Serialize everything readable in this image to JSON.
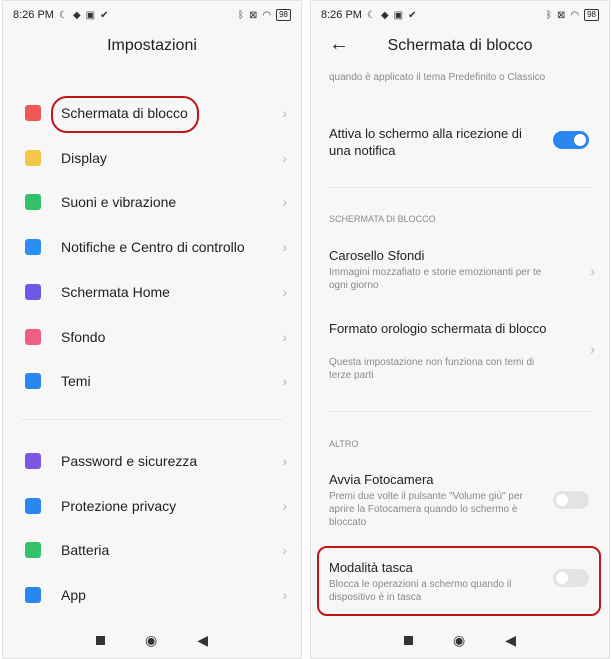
{
  "statusbar": {
    "time": "8:26 PM",
    "battery": "98"
  },
  "left": {
    "title": "Impostazioni",
    "items": [
      {
        "label": "Schermata di blocco",
        "icon": "lock-icon",
        "color": "#ef5a56"
      },
      {
        "label": "Display",
        "icon": "sun-icon",
        "color": "#f3c84a"
      },
      {
        "label": "Suoni e vibrazione",
        "icon": "speaker-icon",
        "color": "#31c26a"
      },
      {
        "label": "Notifiche e Centro di controllo",
        "icon": "notification-icon",
        "color": "#2b8ef5"
      },
      {
        "label": "Schermata Home",
        "icon": "home-icon",
        "color": "#6b59e8"
      },
      {
        "label": "Sfondo",
        "icon": "tulip-icon",
        "color": "#ef5f83"
      },
      {
        "label": "Temi",
        "icon": "brush-icon",
        "color": "#2b86f0"
      },
      {
        "label": "Password e sicurezza",
        "icon": "fingerprint-icon",
        "color": "#7b56e3"
      },
      {
        "label": "Protezione privacy",
        "icon": "shield-icon",
        "color": "#2b86f0"
      },
      {
        "label": "Batteria",
        "icon": "battery-icon",
        "color": "#31c26a"
      },
      {
        "label": "App",
        "icon": "gear-icon",
        "color": "#2b86f0"
      }
    ]
  },
  "right": {
    "title": "Schermata di blocco",
    "top_note": "quando è applicato il tema Predefinito o Classico",
    "wake": {
      "title": "Attiva lo schermo alla ricezione di una notifica",
      "on": true
    },
    "sec1": "SCHERMATA DI BLOCCO",
    "carousel": {
      "title": "Carosello Sfondi",
      "sub": "Immagini mozzafiato e storie emozionanti per te ogni giorno"
    },
    "clock": {
      "title": "Formato orologio schermata di blocco",
      "sub": "Questa impostazione non funziona con temi di terze parti"
    },
    "sec2": "ALTRO",
    "camera": {
      "title": "Avvia Fotocamera",
      "sub": "Premi due volte il pulsante \"Volume giù\" per aprire la Fotocamera quando lo schermo è bloccato",
      "on": false
    },
    "pocket": {
      "title": "Modalità tasca",
      "sub": "Blocca le operazioni a schermo quando il dispositivo è in tasca",
      "on": false
    }
  },
  "colors": {
    "accent": "#2b86f0",
    "highlight": "#c0161a"
  }
}
